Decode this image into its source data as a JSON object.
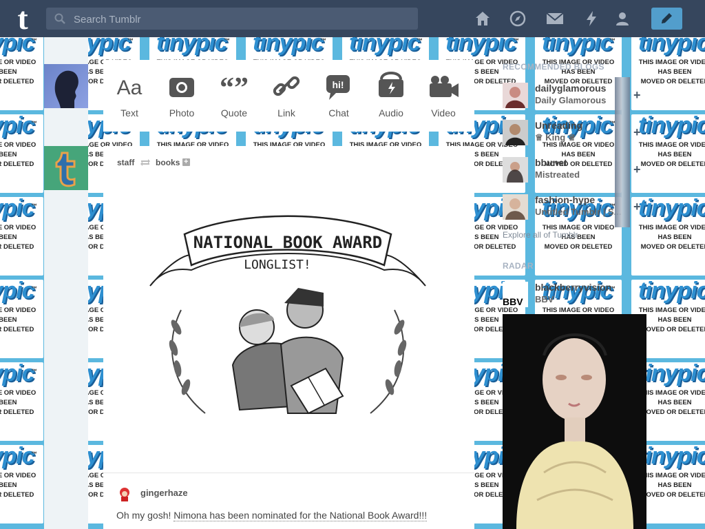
{
  "header": {
    "logo": "t",
    "search_placeholder": "Search Tumblr",
    "nav_icons": [
      "home-icon",
      "explore-icon",
      "inbox-icon",
      "activity-icon",
      "account-icon"
    ],
    "compose_icon": "pencil-icon"
  },
  "background_tile": {
    "logo_text": "tinypic",
    "tm": "™",
    "message_lines": [
      "THIS IMAGE OR VIDEO",
      "HAS BEEN",
      "MOVED OR DELETED"
    ]
  },
  "post_types": [
    {
      "label": "Text",
      "icon": "text-icon"
    },
    {
      "label": "Photo",
      "icon": "camera-icon"
    },
    {
      "label": "Quote",
      "icon": "quote-icon"
    },
    {
      "label": "Link",
      "icon": "link-icon"
    },
    {
      "label": "Chat",
      "icon": "chat-icon"
    },
    {
      "label": "Audio",
      "icon": "audio-icon"
    },
    {
      "label": "Video",
      "icon": "video-icon"
    }
  ],
  "post": {
    "author": "staff",
    "reblogged_from": "books",
    "follow": "+",
    "art_lines": [
      "NATIONAL BOOK AWARD",
      "LONGLIST!"
    ],
    "source_user": "gingerhaze",
    "caption_prefix": "Oh my gosh! ",
    "caption_link": "Nimona has been nominated for the National Book Award!!!"
  },
  "sidebar": {
    "recommended_heading": "RECOMMENDED BLOGS",
    "blogs": [
      {
        "name": "dailyglamorous",
        "title": "Daily Glamorous"
      },
      {
        "name": "Unreading",
        "title": "♕ King ♕"
      },
      {
        "name": "bbunet",
        "title": "Mistreated"
      },
      {
        "name": "fashion-hype",
        "title": "Untitled Tumblr | S..."
      }
    ],
    "follow_label": "+",
    "explore": "Explore all of Tumblr",
    "radar_heading": "RADAR",
    "radar_blog": {
      "name": "blackberryvision",
      "title": "BBV",
      "logo": "BBV"
    }
  },
  "colors": {
    "header_bg": "#36465d",
    "accent": "#529ecc",
    "page_bg": "#5bb8df"
  }
}
